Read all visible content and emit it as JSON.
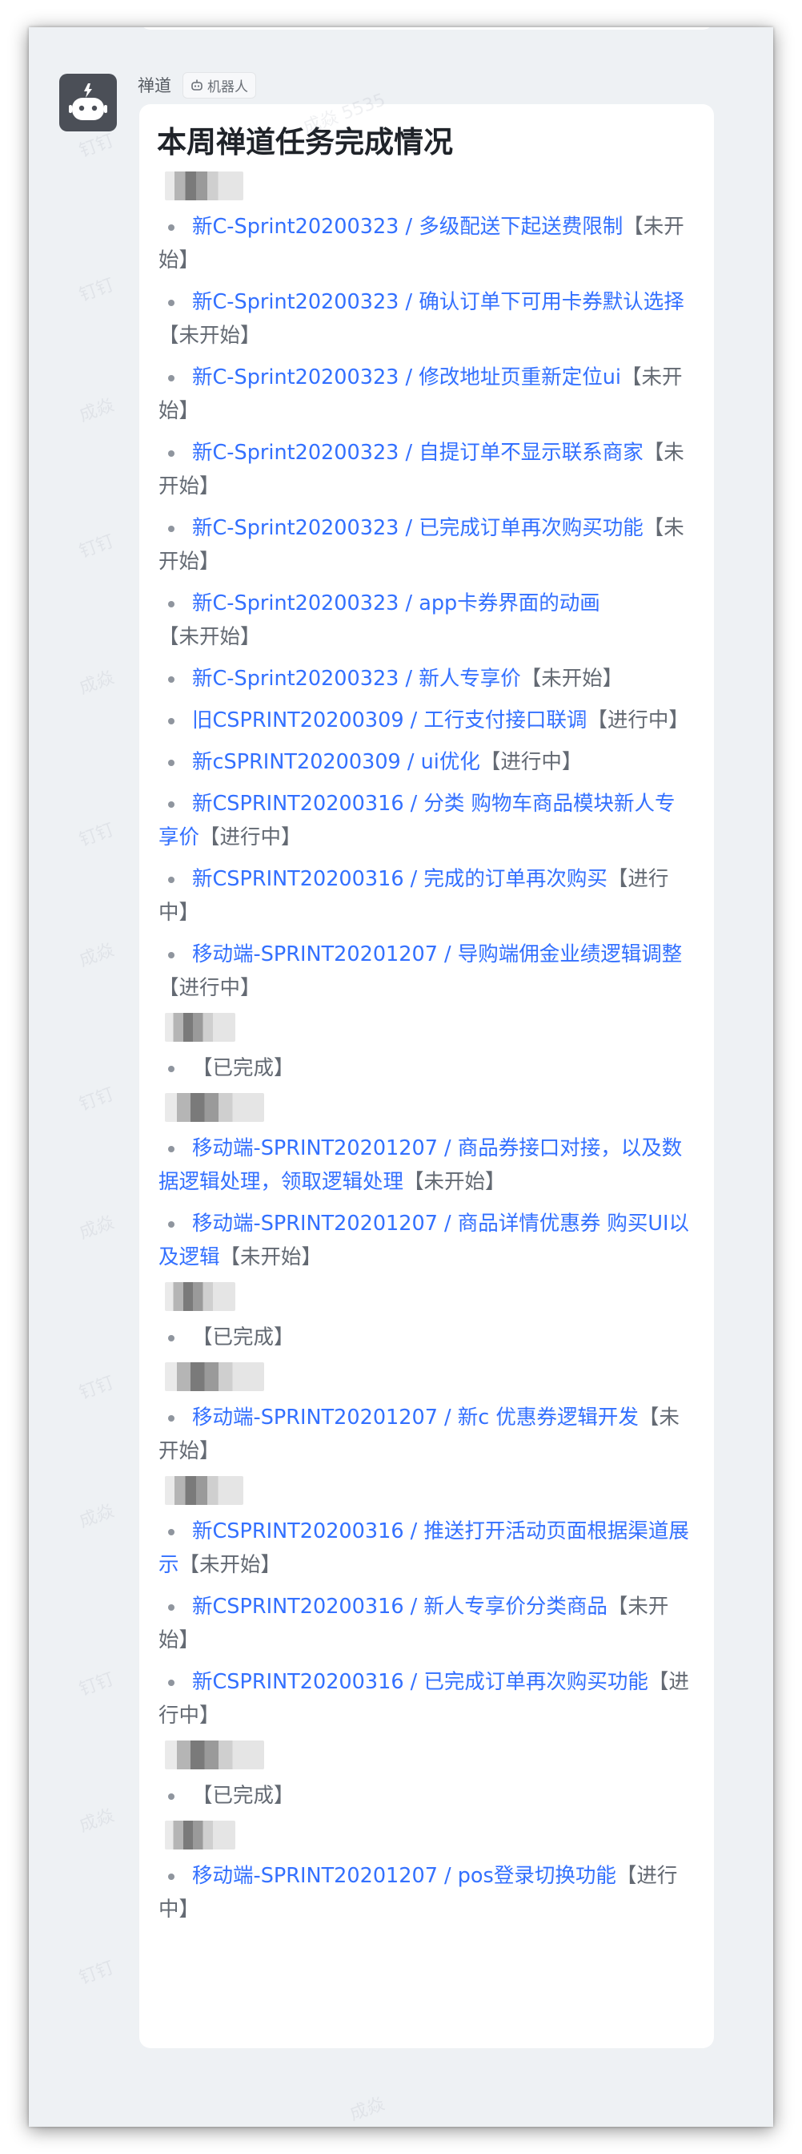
{
  "message": {
    "sender_name": "禅道",
    "sender_badge": "机器人",
    "title": "本周禅道任务完成情况",
    "groups": [
      {
        "tasks": [
          {
            "text": "新C-Sprint20200323 / 多级配送下起送费限制",
            "status": "【未开始】"
          },
          {
            "text": "新C-Sprint20200323 / 确认订单下可用卡券默认选择",
            "status": "【未开始】"
          },
          {
            "text": "新C-Sprint20200323 / 修改地址页重新定位ui",
            "status": "【未开始】"
          },
          {
            "text": "新C-Sprint20200323 / 自提订单不显示联系商家",
            "status": "【未开始】"
          },
          {
            "text": "新C-Sprint20200323 / 已完成订单再次购买功能",
            "status": "【未开始】"
          },
          {
            "text": "新C-Sprint20200323 / app卡券界面的动画",
            "status": "【未开始】"
          },
          {
            "text": "新C-Sprint20200323 / 新人专享价",
            "status": "【未开始】"
          },
          {
            "text": "旧CSPRINT20200309 / 工行支付接口联调",
            "status": "【进行中】"
          },
          {
            "text": "新cSPRINT20200309 / ui优化",
            "status": "【进行中】"
          },
          {
            "text": "新CSPRINT20200316 / 分类 购物车商品模块新人专享价",
            "status": "【进行中】"
          },
          {
            "text": "新CSPRINT20200316 / 完成的订单再次购买",
            "status": "【进行中】"
          },
          {
            "text": "移动端-SPRINT20201207 / 导购端佣金业绩逻辑调整",
            "status": "【进行中】"
          }
        ]
      },
      {
        "tasks": [
          {
            "text": "",
            "status": "【已完成】"
          }
        ]
      },
      {
        "tasks": [
          {
            "text": "移动端-SPRINT20201207 / 商品券接口对接，以及数据逻辑处理，领取逻辑处理",
            "status": "【未开始】"
          },
          {
            "text": "移动端-SPRINT20201207 / 商品详情优惠券 购买UI以及逻辑",
            "status": "【未开始】"
          }
        ]
      },
      {
        "tasks": [
          {
            "text": "",
            "status": "【已完成】"
          }
        ]
      },
      {
        "tasks": [
          {
            "text": "移动端-SPRINT20201207 / 新c 优惠券逻辑开发",
            "status": "【未开始】"
          }
        ]
      },
      {
        "tasks": [
          {
            "text": "新CSPRINT20200316 / 推送打开活动页面根据渠道展示",
            "status": "【未开始】"
          },
          {
            "text": "新CSPRINT20200316 / 新人专享价分类商品",
            "status": "【未开始】"
          },
          {
            "text": "新CSPRINT20200316 / 已完成订单再次购买功能",
            "status": "【进行中】"
          }
        ]
      },
      {
        "tasks": [
          {
            "text": "",
            "status": "【已完成】"
          }
        ]
      },
      {
        "tasks": [
          {
            "text": "移动端-SPRINT20201207 / pos登录切换功能",
            "status": "【进行中】"
          }
        ]
      }
    ]
  },
  "watermark": {
    "texts": [
      "钉钉",
      "成焱",
      "成焱 5535"
    ]
  },
  "colors": {
    "link": "#3370ff",
    "status": "#646a73",
    "bubble": "#ffffff",
    "chat_background": "#eef1f4",
    "avatar": "#4b4f57"
  }
}
